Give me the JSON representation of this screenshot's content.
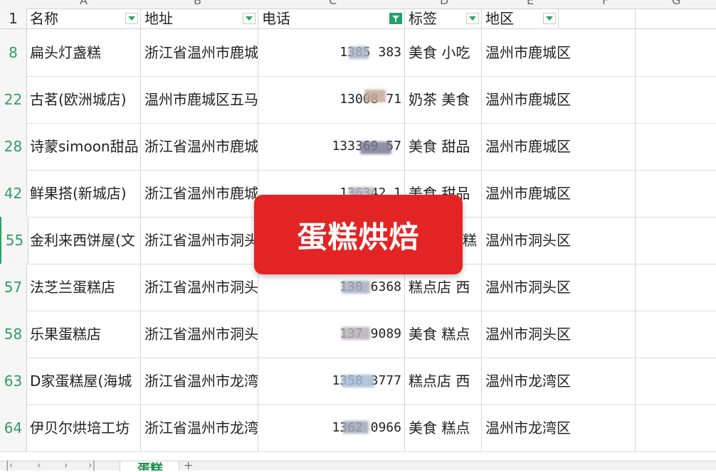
{
  "columns": {
    "letters": [
      "A",
      "B",
      "C",
      "D",
      "E",
      "F",
      "G"
    ]
  },
  "header": {
    "row_number": "1",
    "name": "名称",
    "address": "地址",
    "phone": "电话",
    "tags": "标签",
    "district": "地区"
  },
  "rows": [
    {
      "row_number": "8",
      "name": "扁头灯盏糕",
      "address": "浙江省温州市鹿城",
      "phone": "1385    383",
      "tags": "美食 小吃",
      "district": "温州市鹿城区"
    },
    {
      "row_number": "22",
      "name": "古茗(欧洲城店)",
      "address": "温州市鹿城区五马",
      "phone": "13008    71",
      "tags": "奶茶 美食",
      "district": "温州市鹿城区"
    },
    {
      "row_number": "28",
      "name": "诗蒙simoon甜品",
      "address": "浙江省温州市鹿城",
      "phone": "133369    57",
      "tags": "美食 甜品",
      "district": "温州市鹿城区"
    },
    {
      "row_number": "42",
      "name": "鲜果搭(新城店)",
      "address": "浙江省温州市鹿城",
      "phone": "136342    1",
      "tags": "美食 甜品",
      "district": "温州市鹿城区"
    },
    {
      "row_number": "55",
      "name": "金利来西饼屋(文",
      "address": "浙江省温州市洞头",
      "phone": "",
      "tags": "蛋糕",
      "district": "温州市洞头区"
    },
    {
      "row_number": "57",
      "name": "法芝兰蛋糕店",
      "address": "浙江省温州市洞头",
      "phone": "130    6368",
      "tags": "糕点店 西",
      "district": "温州市洞头区"
    },
    {
      "row_number": "58",
      "name": "乐果蛋糕店",
      "address": "浙江省温州市洞头",
      "phone": "137    9089",
      "tags": "美食 糕点",
      "district": "温州市洞头区"
    },
    {
      "row_number": "63",
      "name": "D家蛋糕屋(海城",
      "address": "浙江省温州市龙湾",
      "phone": "1358    3777",
      "tags": "糕点店 西",
      "district": "温州市龙湾区"
    },
    {
      "row_number": "64",
      "name": "伊贝尔烘培工坊",
      "address": "浙江省温州市龙湾",
      "phone": "1362  0966",
      "tags": "美食 糕点",
      "district": "温州市龙湾区"
    }
  ],
  "sheet_tab": {
    "label": "蛋糕"
  },
  "banner": {
    "text": "蛋糕烘焙"
  },
  "colors": {
    "accent_green": "#21a366",
    "banner_red": "#e32424",
    "row_number_green": "#2f9e63"
  },
  "icons": {
    "filter": "filter-dropdown-icon",
    "active_filter": "funnel-filter-icon",
    "add_sheet": "plus-icon"
  }
}
